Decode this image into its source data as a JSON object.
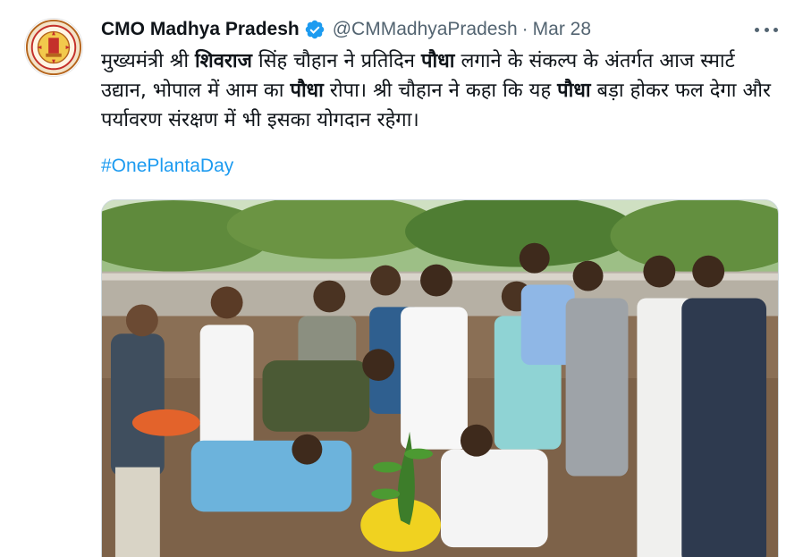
{
  "tweet": {
    "display_name": "CMO Madhya Pradesh",
    "handle": "@CMMadhyaPradesh",
    "separator": "·",
    "date": "Mar 28",
    "verified_icon": "verified-badge-icon",
    "more_icon": "more-options-icon",
    "text": {
      "p1": "मुख्यमंत्री श्री ",
      "b1": "शिवराज",
      "p2": " सिंह चौहान ने प्रतिदिन ",
      "b2": "पौधा",
      "p3": " लगाने के संकल्प के अंतर्गत आज स्मार्ट उद्यान, भोपाल में आम का ",
      "b3": "पौधा",
      "p4": " रोपा। श्री चौहान ने कहा कि यह ",
      "b4": "पौधा",
      "p5": " बड़ा होकर फल देगा और पर्यावरण संरक्षण में भी इसका योगदान रहेगा।"
    },
    "hashtag": "#OnePlantaDay"
  },
  "colors": {
    "accent": "#1d9bf0",
    "secondary_text": "#536471",
    "primary_text": "#0f1419",
    "verified": "#1d9bf0"
  }
}
